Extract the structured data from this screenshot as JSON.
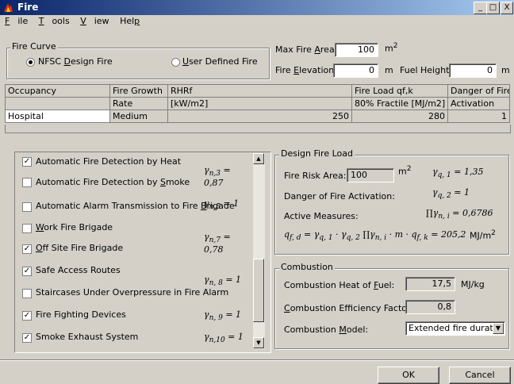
{
  "window": {
    "title": "Fire",
    "minimize": "_",
    "maximize": "□",
    "close": "X"
  },
  "menu": [
    {
      "label": "File",
      "key": "F"
    },
    {
      "label": "Tools",
      "key": "T"
    },
    {
      "label": "View",
      "key": "V"
    },
    {
      "label": "Help",
      "key": "p"
    }
  ],
  "fire_curve": {
    "group_label": "Fire Curve",
    "option1": "NFSC Design Fire",
    "option2": "User Defined Fire",
    "selected": "NFSC Design Fire"
  },
  "area": {
    "max_area_label": "Max Fire Area:",
    "max_area_value": "100",
    "max_area_unit": "m2",
    "elevation_label": "Fire Elevation:",
    "elevation_value": "0",
    "elevation_unit": "m",
    "fuel_height_label": "Fuel Height:",
    "fuel_height_value": "0",
    "fuel_height_unit": "m"
  },
  "table": {
    "header1": [
      "Occupancy",
      "Fire Growth",
      "RHRf",
      "Fire Load qf,k",
      "Danger of Fire"
    ],
    "header2": [
      "",
      "Rate",
      "[kW/m2]",
      "80% Fractile [MJ/m2]",
      "Activation"
    ],
    "row": [
      "Hospital",
      "Medium",
      "250",
      "280",
      "1"
    ]
  },
  "measures": [
    {
      "label": "Automatic Fire Detection by Heat",
      "checked": true,
      "gamma": "γn,3 = 0,87"
    },
    {
      "label": "Automatic Fire Detection by Smoke",
      "checked": false,
      "gamma": ""
    },
    {
      "label": "Automatic Alarm Transmission to Fire Brigade",
      "checked": false,
      "gamma": "γn,5 = 1"
    },
    {
      "label": "Work Fire Brigade",
      "checked": false,
      "gamma": ""
    },
    {
      "label": "Off Site Fire Brigade",
      "checked": true,
      "gamma": "γn,7 = 0,78"
    },
    {
      "label": "Safe Access Routes",
      "checked": true,
      "gamma": ""
    },
    {
      "label": "Staircases Under Overpressure in Fire Alarm",
      "checked": false,
      "gamma": "γn, 8 = 1"
    },
    {
      "label": "Fire Fighting Devices",
      "checked": true,
      "gamma": "γn, 9 = 1"
    },
    {
      "label": "Smoke Exhaust System",
      "checked": true,
      "gamma": "γn,10 = 1"
    }
  ],
  "design_fire_load": {
    "group_label": "Design Fire Load",
    "risk_area_label": "Fire Risk Area:",
    "risk_area_value": "100",
    "risk_area_unit": "m2",
    "gamma_q1": "γq, 1 = 1,35",
    "danger_label": "Danger of Fire Activation:",
    "gamma_q2": "γq, 2 = 1",
    "active_label": "Active Measures:",
    "prod_gamma": "∏γn, i = 0,6786",
    "formula": "qf, d = γq, 1 · γq, 2 ∏γn, i · m · qf, k = 205,2",
    "formula_unit": "MJ/m2"
  },
  "combustion": {
    "group_label": "Combustion",
    "heat_label": "Combustion Heat of Fuel:",
    "heat_value": "17,5",
    "heat_unit": "MJ/kg",
    "eff_label": "Combustion Efficiency Factor:",
    "eff_value": "0,8",
    "model_label": "Combustion Model:",
    "model_value": "Extended fire duratio"
  },
  "buttons": {
    "ok": "OK",
    "cancel": "Cancel"
  }
}
